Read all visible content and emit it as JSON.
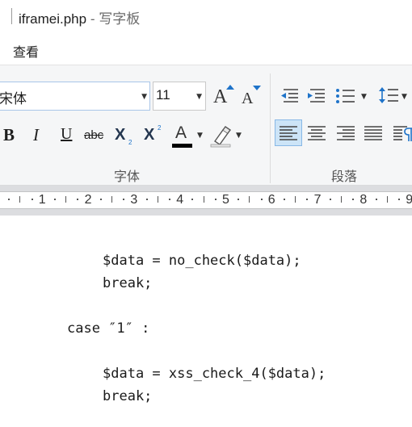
{
  "title": {
    "file": "iframei.php",
    "separator": " - ",
    "app": "写字板"
  },
  "menu": {
    "view": "查看"
  },
  "ribbon": {
    "font": {
      "name": "宋体",
      "size": "11",
      "group_label": "字体",
      "text_color": "#000000"
    },
    "paragraph": {
      "group_label": "段落"
    }
  },
  "ruler": {
    "numbers": [
      "1",
      "2",
      "3",
      "4",
      "5",
      "6",
      "7",
      "8",
      "9"
    ]
  },
  "document": {
    "lines": [
      "$data = no_check($data);",
      "break;",
      "case ″1″ :",
      "$data = xss_check_4($data);",
      "break;"
    ]
  },
  "colors": {
    "accent": "#1e73c9",
    "ribbon_bg": "#f5f6f7",
    "ruler_bg": "#dcdde0",
    "selected_bg": "#cce4f7"
  },
  "icons": {
    "font_format": [
      "bold-icon",
      "italic-icon",
      "underline-icon",
      "strikethrough-icon",
      "subscript-icon",
      "superscript-icon",
      "text-color-icon",
      "highlight-icon"
    ],
    "paragraph": [
      "decrease-indent-icon",
      "increase-indent-icon",
      "bullet-list-icon",
      "line-spacing-icon",
      "align-left-icon",
      "align-center-icon",
      "align-right-icon",
      "justify-icon",
      "paragraph-icon"
    ]
  }
}
